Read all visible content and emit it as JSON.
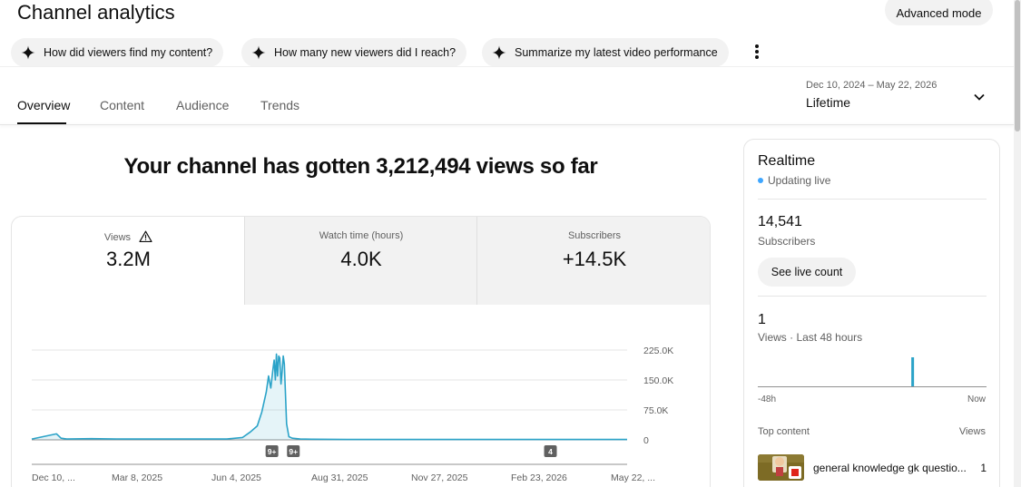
{
  "header": {
    "title": "Channel analytics",
    "advanced_mode_label": "Advanced mode"
  },
  "suggestions": [
    {
      "label": "How did viewers find my content?"
    },
    {
      "label": "How many new viewers did I reach?"
    },
    {
      "label": "Summarize my latest video performance"
    }
  ],
  "tabs": [
    {
      "label": "Overview",
      "active": true
    },
    {
      "label": "Content",
      "active": false
    },
    {
      "label": "Audience",
      "active": false
    },
    {
      "label": "Trends",
      "active": false
    }
  ],
  "date_picker": {
    "range": "Dec 10, 2024 – May 22, 2026",
    "preset": "Lifetime"
  },
  "headline": "Your channel has gotten 3,212,494 views so far",
  "metrics": [
    {
      "label": "Views",
      "value": "3.2M",
      "warning": true
    },
    {
      "label": "Watch time (hours)",
      "value": "4.0K",
      "warning": false
    },
    {
      "label": "Subscribers",
      "value": "+14.5K",
      "warning": false
    }
  ],
  "chart_data": {
    "type": "area",
    "y_tick_labels": [
      "225.0K",
      "150.0K",
      "75.0K",
      "0"
    ],
    "ylim": [
      0,
      225000
    ],
    "x_tick_labels": [
      "Dec 10, ...",
      "Mar 8, 2025",
      "Jun 4, 2025",
      "Aug 31, 2025",
      "Nov 27, 2025",
      "Feb 23, 2026",
      "May 22, ..."
    ],
    "x": [
      "2024-12-10",
      "2025-01-01",
      "2025-01-05",
      "2025-01-10",
      "2025-02-01",
      "2025-03-01",
      "2025-04-01",
      "2025-05-01",
      "2025-06-01",
      "2025-06-15",
      "2025-06-22",
      "2025-06-28",
      "2025-07-02",
      "2025-07-06",
      "2025-07-08",
      "2025-07-10",
      "2025-07-12",
      "2025-07-13",
      "2025-07-14",
      "2025-07-15",
      "2025-07-16",
      "2025-07-17",
      "2025-07-18",
      "2025-07-19",
      "2025-07-20",
      "2025-07-21",
      "2025-07-22",
      "2025-07-24",
      "2025-07-26",
      "2025-07-29",
      "2025-08-05",
      "2025-08-15",
      "2025-09-15",
      "2025-11-01",
      "2026-01-01",
      "2026-03-01",
      "2026-05-22"
    ],
    "values": [
      2000,
      15000,
      4000,
      2000,
      3000,
      2000,
      2000,
      2000,
      2000,
      6000,
      20000,
      35000,
      70000,
      120000,
      160000,
      130000,
      180000,
      200000,
      150000,
      215000,
      160000,
      210000,
      205000,
      140000,
      170000,
      210000,
      190000,
      40000,
      8000,
      4000,
      2000,
      1500,
      1000,
      1000,
      1000,
      1000,
      1000
    ],
    "annotations": [
      {
        "date": "2025-07-11",
        "label": "9+"
      },
      {
        "date": "2025-07-30",
        "label": "9+"
      },
      {
        "date": "2026-03-15",
        "label": "4"
      }
    ],
    "color": "#2ba3c8"
  },
  "realtime": {
    "title": "Realtime",
    "status": "Updating live",
    "subscribers_value": "14,541",
    "subscribers_label": "Subscribers",
    "live_count_label": "See live count",
    "views_value": "1",
    "views_label": "Views · Last 48 hours",
    "mini_bars": [
      0,
      0,
      0,
      0,
      0,
      0,
      0,
      0,
      0,
      0,
      0,
      0,
      0,
      0,
      0,
      0,
      0,
      0,
      0,
      0,
      0,
      0,
      0,
      0,
      0,
      0,
      0,
      0,
      0,
      0,
      0,
      0,
      1,
      0,
      0,
      0,
      0,
      0,
      0,
      0,
      0,
      0,
      0,
      0,
      0,
      0,
      0,
      0
    ],
    "axis_left": "-48h",
    "axis_right": "Now",
    "top_content_label": "Top content",
    "views_col_label": "Views",
    "top_items": [
      {
        "title": "general knowledge gk questio...",
        "views": "1"
      }
    ]
  }
}
